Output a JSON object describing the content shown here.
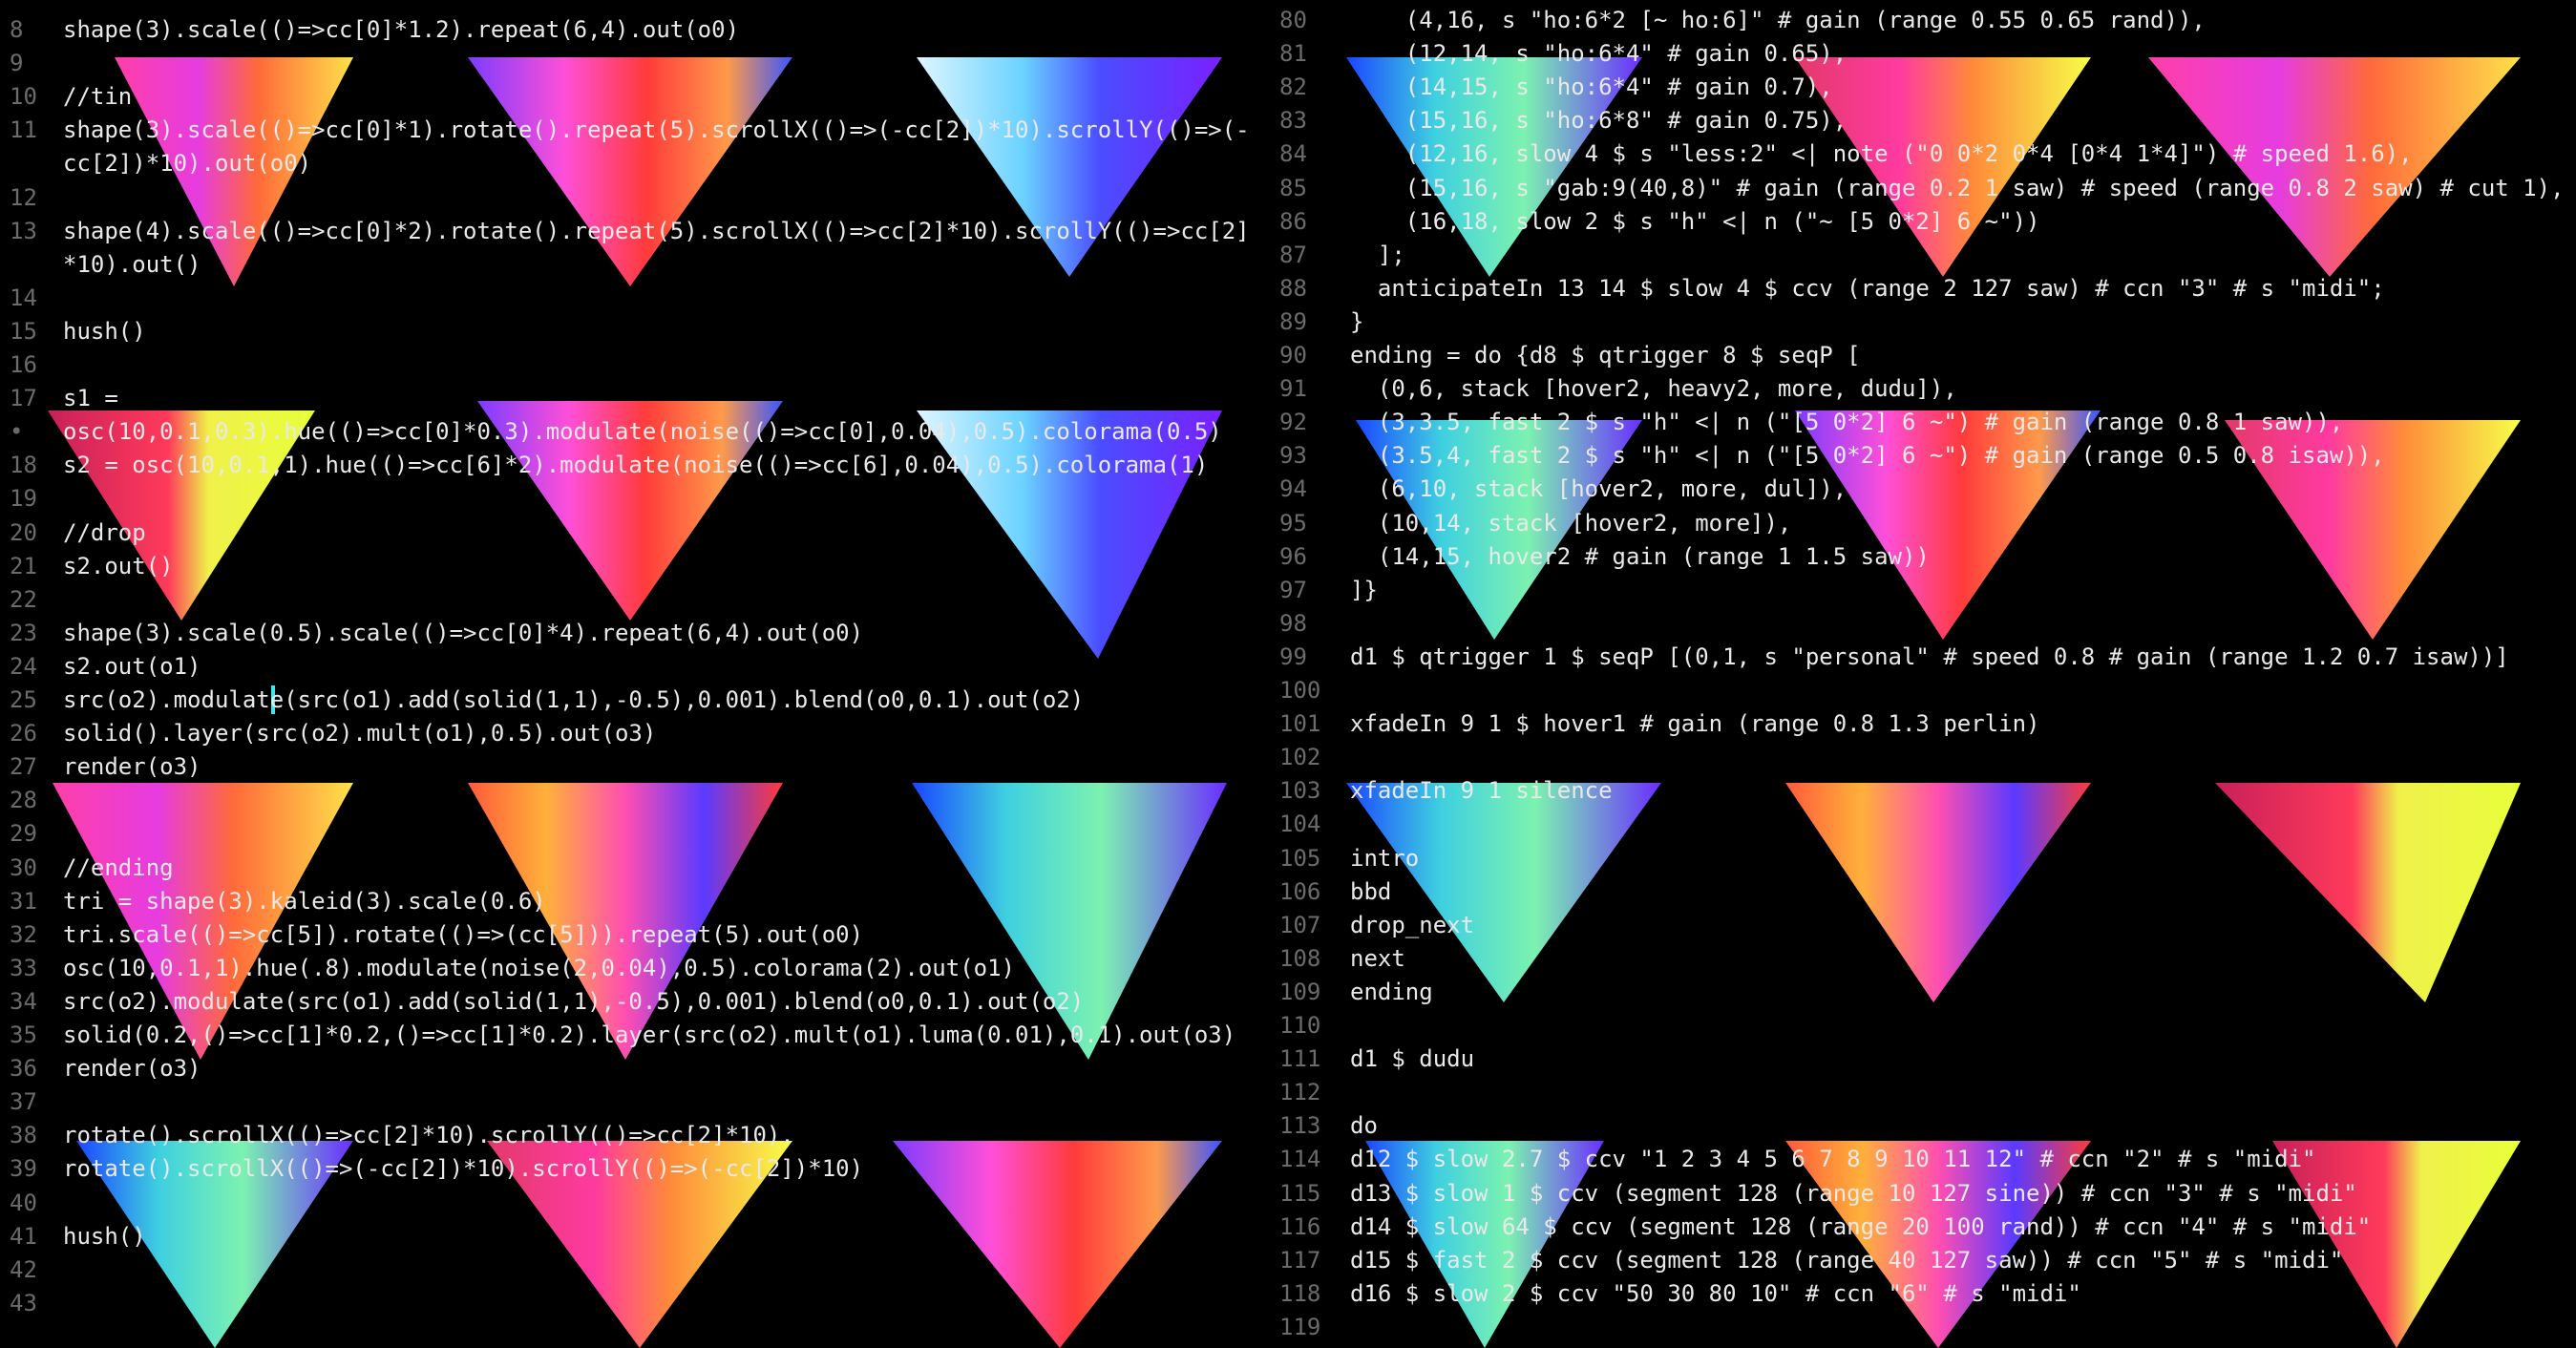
{
  "left_editor": {
    "lines": [
      {
        "num": "8",
        "text": "shape(3).scale(()=>cc[0]*1.2).repeat(6,4).out(o0)"
      },
      {
        "num": "9",
        "text": ""
      },
      {
        "num": "10",
        "text": "//tin"
      },
      {
        "num": "11",
        "text": "shape(3).scale(()=>cc[0]*1).rotate().repeat(5).scrollX(()=>(-cc[2])*10).scrollY(()=>(-"
      },
      {
        "num": "",
        "text": "cc[2])*10).out(o0)"
      },
      {
        "num": "12",
        "text": ""
      },
      {
        "num": "13",
        "text": "shape(4).scale(()=>cc[0]*2).rotate().repeat(5).scrollX(()=>cc[2]*10).scrollY(()=>cc[2]"
      },
      {
        "num": "",
        "text": "*10).out()"
      },
      {
        "num": "14",
        "text": ""
      },
      {
        "num": "15",
        "text": "hush()"
      },
      {
        "num": "16",
        "text": ""
      },
      {
        "num": "17",
        "text": "s1 ="
      },
      {
        "num": "•",
        "text": "osc(10,0.1,0.3).hue(()=>cc[0]*0.3).modulate(noise(()=>cc[0],0.04),0.5).colorama(0.5)"
      },
      {
        "num": "18",
        "text": "s2 = osc(10,0.1,1).hue(()=>cc[6]*2).modulate(noise(()=>cc[6],0.04),0.5).colorama(1)"
      },
      {
        "num": "19",
        "text": ""
      },
      {
        "num": "20",
        "text": "//drop"
      },
      {
        "num": "21",
        "text": "s2.out()"
      },
      {
        "num": "22",
        "text": ""
      },
      {
        "num": "23",
        "text": "shape(3).scale(0.5).scale(()=>cc[0]*4).repeat(6,4).out(o0)"
      },
      {
        "num": "24",
        "text": "s2.out(o1)"
      },
      {
        "num": "25",
        "text": "src(o2).modulate(src(o1).add(solid(1,1),-0.5),0.001).blend(o0,0.1).out(o2)"
      },
      {
        "num": "26",
        "text": "solid().layer(src(o2).mult(o1),0.5).out(o3)"
      },
      {
        "num": "27",
        "text": "render(o3)"
      },
      {
        "num": "28",
        "text": ""
      },
      {
        "num": "29",
        "text": ""
      },
      {
        "num": "30",
        "text": "//ending"
      },
      {
        "num": "31",
        "text": "tri = shape(3).kaleid(3).scale(0.6)"
      },
      {
        "num": "32",
        "text": "tri.scale(()=>cc[5]).rotate(()=>(cc[5])).repeat(5).out(o0)"
      },
      {
        "num": "33",
        "text": "osc(10,0.1,1).hue(.8).modulate(noise(2,0.04),0.5).colorama(2).out(o1)"
      },
      {
        "num": "34",
        "text": "src(o2).modulate(src(o1).add(solid(1,1),-0.5),0.001).blend(o0,0.1).out(o2)"
      },
      {
        "num": "35",
        "text": "solid(0.2,()=>cc[1]*0.2,()=>cc[1]*0.2).layer(src(o2).mult(o1).luma(0.01),0.1).out(o3)"
      },
      {
        "num": "36",
        "text": "render(o3)"
      },
      {
        "num": "37",
        "text": ""
      },
      {
        "num": "38",
        "text": "rotate().scrollX(()=>cc[2]*10).scrollY(()=>cc[2]*10)."
      },
      {
        "num": "39",
        "text": "rotate().scrollX(()=>(-cc[2])*10).scrollY(()=>(-cc[2])*10)"
      },
      {
        "num": "40",
        "text": ""
      },
      {
        "num": "41",
        "text": "hush()"
      },
      {
        "num": "42",
        "text": ""
      },
      {
        "num": "43",
        "text": ""
      }
    ]
  },
  "right_editor": {
    "lines": [
      {
        "num": "80",
        "text": "    (4,16, s \"ho:6*2 [~ ho:6]\" # gain (range 0.55 0.65 rand)),"
      },
      {
        "num": "81",
        "text": "    (12,14, s \"ho:6*4\" # gain 0.65),"
      },
      {
        "num": "82",
        "text": "    (14,15, s \"ho:6*4\" # gain 0.7),"
      },
      {
        "num": "83",
        "text": "    (15,16, s \"ho:6*8\" # gain 0.75),"
      },
      {
        "num": "84",
        "text": "    (12,16, slow 4 $ s \"less:2\" <| note (\"0 0*2 0*4 [0*4 1*4]\") # speed 1.6),"
      },
      {
        "num": "85",
        "text": "    (15,16, s \"gab:9(40,8)\" # gain (range 0.2 1 saw) # speed (range 0.8 2 saw) # cut 1),"
      },
      {
        "num": "86",
        "text": "    (16,18, slow 2 $ s \"h\" <| n (\"~ [5 0*2] 6 ~\"))"
      },
      {
        "num": "87",
        "text": "  ];"
      },
      {
        "num": "88",
        "text": "  anticipateIn 13 14 $ slow 4 $ ccv (range 2 127 saw) # ccn \"3\" # s \"midi\";"
      },
      {
        "num": "89",
        "text": "}"
      },
      {
        "num": "90",
        "text": "ending = do {d8 $ qtrigger 8 $ seqP ["
      },
      {
        "num": "91",
        "text": "  (0,6, stack [hover2, heavy2, more, dudu]),"
      },
      {
        "num": "92",
        "text": "  (3,3.5, fast 2 $ s \"h\" <| n (\"[5 0*2] 6 ~\") # gain (range 0.8 1 saw)),"
      },
      {
        "num": "93",
        "text": "  (3.5,4, fast 2 $ s \"h\" <| n (\"[5 0*2] 6 ~\") # gain (range 0.5 0.8 isaw)),"
      },
      {
        "num": "94",
        "text": "  (6,10, stack [hover2, more, dul]),"
      },
      {
        "num": "95",
        "text": "  (10,14, stack [hover2, more]),"
      },
      {
        "num": "96",
        "text": "  (14,15, hover2 # gain (range 1 1.5 saw))"
      },
      {
        "num": "97",
        "text": "]}"
      },
      {
        "num": "98",
        "text": ""
      },
      {
        "num": "99",
        "text": "d1 $ qtrigger 1 $ seqP [(0,1, s \"personal\" # speed 0.8 # gain (range 1.2 0.7 isaw))]"
      },
      {
        "num": "100",
        "text": ""
      },
      {
        "num": "101",
        "text": "xfadeIn 9 1 $ hover1 # gain (range 0.8 1.3 perlin)"
      },
      {
        "num": "102",
        "text": ""
      },
      {
        "num": "103",
        "text": "xfadeIn 9 1 silence"
      },
      {
        "num": "104",
        "text": ""
      },
      {
        "num": "105",
        "text": "intro"
      },
      {
        "num": "106",
        "text": "bbd"
      },
      {
        "num": "107",
        "text": "drop_next"
      },
      {
        "num": "108",
        "text": "next"
      },
      {
        "num": "109",
        "text": "ending"
      },
      {
        "num": "110",
        "text": ""
      },
      {
        "num": "111",
        "text": "d1 $ dudu"
      },
      {
        "num": "112",
        "text": ""
      },
      {
        "num": "113",
        "text": "do"
      },
      {
        "num": "114",
        "text": "d12 $ slow 2.7 $ ccv \"1 2 3 4 5 6 7 8 9 10 11 12\" # ccn \"2\" # s \"midi\""
      },
      {
        "num": "115",
        "text": "d13 $ slow 1 $ ccv (segment 128 (range 10 127 sine)) # ccn \"3\" # s \"midi\""
      },
      {
        "num": "116",
        "text": "d14 $ slow 64 $ ccv (segment 128 (range 20 100 rand)) # ccn \"4\" # s \"midi\""
      },
      {
        "num": "117",
        "text": "d15 $ fast 2 $ ccv (segment 128 (range 40 127 saw)) # ccn \"5\" # s \"midi\""
      },
      {
        "num": "118",
        "text": "d16 $ slow 2 $ ccv \"50 30 80 10\" # ccn \"6\" # s \"midi\""
      },
      {
        "num": "119",
        "text": ""
      }
    ]
  },
  "colors": {
    "background": "#000000",
    "code_text": "#e9e9e9",
    "line_number": "#6b6b6b",
    "cursor": "#3ee7f0"
  }
}
